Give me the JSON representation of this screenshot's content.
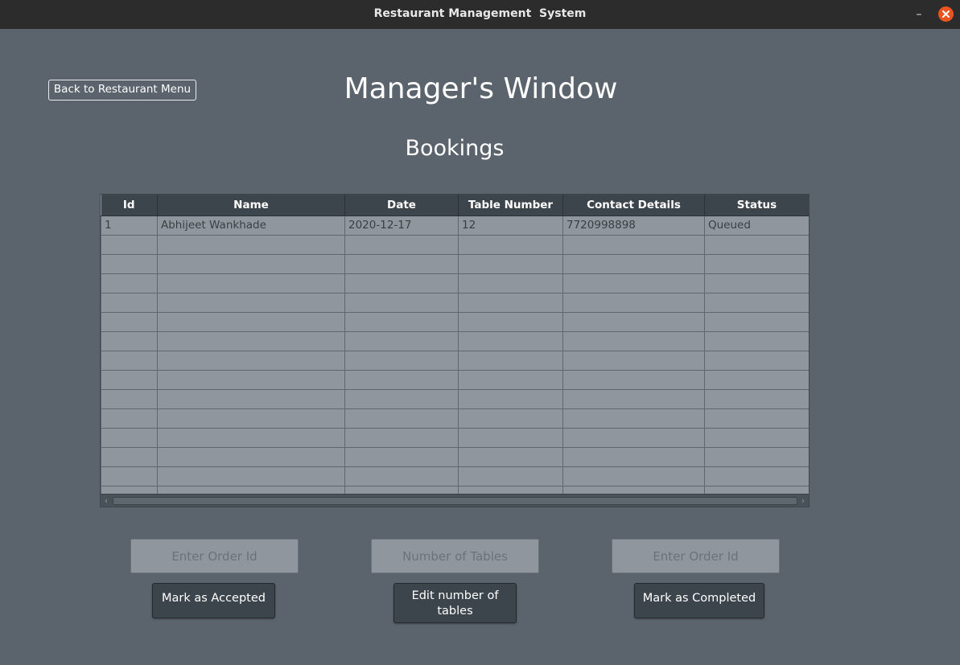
{
  "window": {
    "title": "Restaurant Management  System",
    "minimize_glyph": "–",
    "close_icon": "close-icon",
    "close_color": "#e95420"
  },
  "header": {
    "back_button": "Back to Restaurant Menu",
    "page_title": "Manager's Window",
    "section_title": "Bookings"
  },
  "table": {
    "columns": [
      "Id",
      "Name",
      "Date",
      "Table Number",
      "Contact Details",
      "Status"
    ],
    "rows": [
      [
        "1",
        "Abhijeet Wankhade",
        "2020-12-17",
        "12",
        "7720998898",
        "Queued"
      ]
    ],
    "empty_rows": 14
  },
  "controls": {
    "accept_input_placeholder": "Enter Order Id",
    "tables_input_placeholder": "Number of Tables",
    "complete_input_placeholder": "Enter Order Id",
    "accept_button": "Mark as Accepted",
    "edit_tables_button": "Edit number of tables",
    "complete_button": "Mark as Completed"
  }
}
